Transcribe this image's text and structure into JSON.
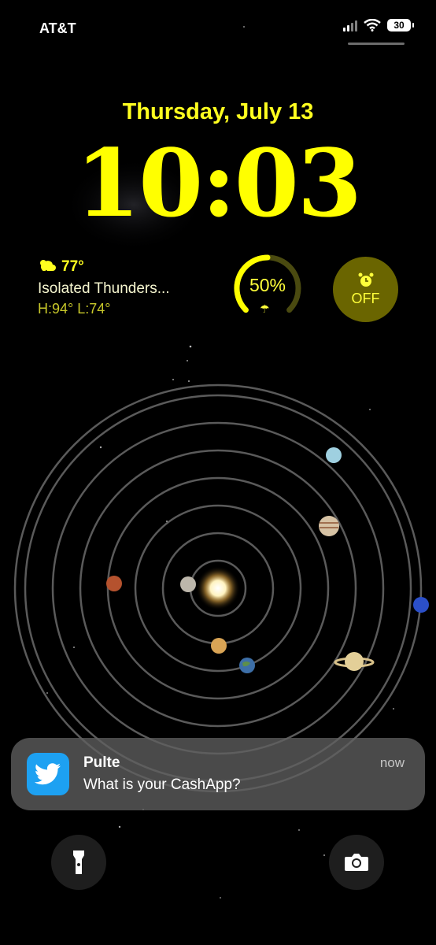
{
  "status_bar": {
    "carrier": "AT&T",
    "battery": "30",
    "signal_icon": "signal-bars-icon",
    "wifi_icon": "wifi-icon"
  },
  "lock_screen": {
    "date": "Thursday, July 13",
    "time": "10:03",
    "accent_color": "#ffff00"
  },
  "weather_widget": {
    "icon": "thunderstorm-cloud-icon",
    "temperature": "77°",
    "condition": "Isolated Thunders...",
    "high_low": "H:94° L:74°"
  },
  "rain_widget": {
    "percent_text": "50%",
    "fraction": 0.5,
    "icon": "umbrella-icon"
  },
  "alarm_widget": {
    "icon": "alarm-clock-icon",
    "label": "OFF"
  },
  "notification": {
    "app_icon": "twitter-bird-icon",
    "title": "Pulte",
    "message": "What is your CashApp?",
    "time": "now"
  },
  "bottom_controls": {
    "flashlight_icon": "flashlight-icon",
    "camera_icon": "camera-icon"
  }
}
